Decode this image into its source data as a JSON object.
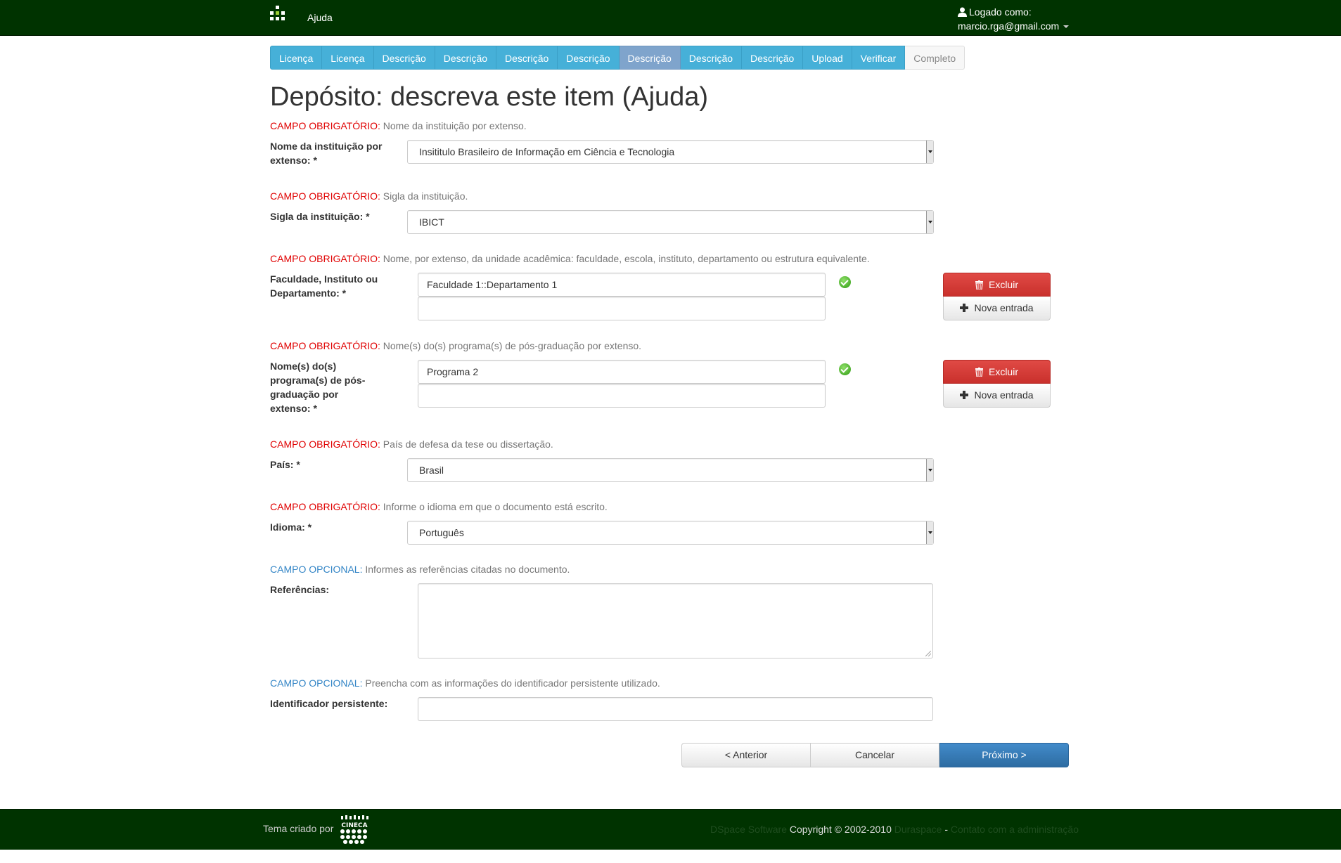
{
  "header": {
    "help_label": "Ajuda",
    "logged_as_label": "Logado como:",
    "user_email": "marcio.rga@gmail.com"
  },
  "steps": [
    {
      "label": "Licença",
      "state": "done"
    },
    {
      "label": "Licença",
      "state": "done"
    },
    {
      "label": "Descrição",
      "state": "done"
    },
    {
      "label": "Descrição",
      "state": "done"
    },
    {
      "label": "Descrição",
      "state": "done"
    },
    {
      "label": "Descrição",
      "state": "done"
    },
    {
      "label": "Descrição",
      "state": "current"
    },
    {
      "label": "Descrição",
      "state": "done"
    },
    {
      "label": "Descrição",
      "state": "done"
    },
    {
      "label": "Upload",
      "state": "done"
    },
    {
      "label": "Verificar",
      "state": "done"
    },
    {
      "label": "Completo",
      "state": "disabled"
    }
  ],
  "page_title": "Depósito: descreva este item (Ajuda)",
  "required_prefix": "CAMPO OBRIGATÓRIO:",
  "optional_prefix": "CAMPO OPCIONAL:",
  "fields": {
    "institution": {
      "hint": " Nome da instituição por extenso.",
      "label": "Nome da instituição por extenso: *",
      "value": "Insititulo Brasileiro de Informação em Ciência e Tecnologia"
    },
    "acronym": {
      "hint": " Sigla da instituição.",
      "label": "Sigla da instituição: *",
      "value": "IBICT"
    },
    "faculty": {
      "hint": " Nome, por extenso, da unidade acadêmica: faculdade, escola, instituto, departamento ou estrutura equivalente.",
      "label": "Faculdade, Instituto ou Departamento: *",
      "value": "Faculdade 1::Departamento 1",
      "new_value": ""
    },
    "program": {
      "hint": " Nome(s) do(s) programa(s) de pós-graduação por extenso.",
      "label": "Nome(s) do(s) programa(s) de pós-graduação por extenso: *",
      "value": "Programa 2",
      "new_value": ""
    },
    "country": {
      "hint": " País de defesa da tese ou dissertação.",
      "label": "País: *",
      "value": "Brasil"
    },
    "language": {
      "hint": " Informe o idioma em que o documento está escrito.",
      "label": "Idioma: *",
      "value": "Português"
    },
    "references": {
      "hint": " Informes as referências citadas no documento.",
      "label": "Referências:",
      "value": ""
    },
    "identifier": {
      "hint": " Preencha com as informações do identificador persistente utilizado.",
      "label": "Identificador persistente:",
      "value": ""
    }
  },
  "buttons": {
    "delete_label": "Excluir",
    "new_entry_label": "Nova entrada",
    "previous_label": "< Anterior",
    "cancel_label": "Cancelar",
    "next_label": "Próximo >"
  },
  "footer": {
    "theme_credit": "Tema criado por",
    "cineca_logo_text": "CINECA",
    "dspace_link": "DSpace Software",
    "copyright": " Copyright © 2002-2010 ",
    "duraspace_link": "Duraspace",
    "separator": " - ",
    "contact_link": "Contato com a administração"
  },
  "colors": {
    "header_bg": "#003300",
    "step_bg": "#46b0d8",
    "step_active_bg": "#7fa4cc",
    "required": "#e00000",
    "optional": "#3385c6",
    "delete_button": "#d9534f",
    "next_button": "#428bca"
  }
}
